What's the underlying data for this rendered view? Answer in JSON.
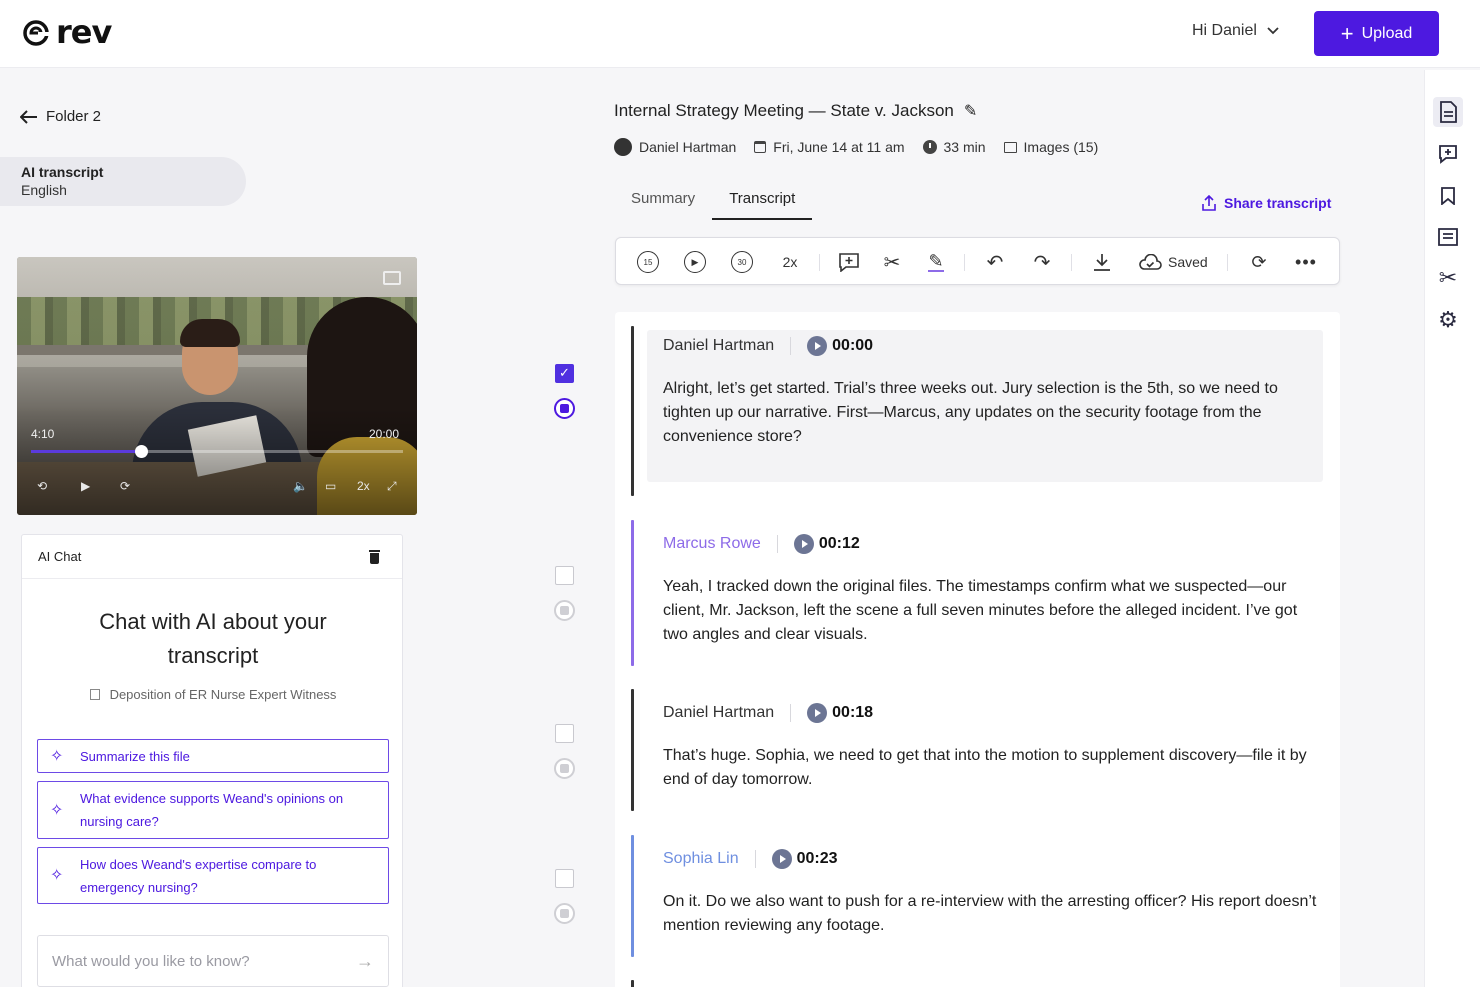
{
  "header": {
    "logo_text": "rev",
    "greeting": "Hi Daniel",
    "upload_label": "Upload",
    "accent_color": "#4d19e0"
  },
  "left": {
    "back_label": "Folder 2",
    "transcript_title": "AI transcript",
    "transcript_language": "English",
    "video": {
      "current_time": "4:10",
      "end_time": "20:00",
      "progress": 0.295,
      "speed_label": "2x"
    },
    "chat": {
      "header": "AI Chat",
      "title": "Chat with AI about your transcript",
      "file_name": "Deposition of ER Nurse Expert Witness",
      "suggestions": [
        "Summarize this file",
        "What evidence supports Weand's opinions on nursing care?",
        "How does Weand's expertise compare to emergency nursing?"
      ],
      "input_placeholder": "What would you like to know?"
    }
  },
  "doc": {
    "title": "Internal Strategy Meeting — State v. Jackson",
    "author": "Daniel Hartman",
    "date": "Fri, June 14 at 11 am",
    "duration": "33 min",
    "images": "Images (15)"
  },
  "tabs": {
    "summary": "Summary",
    "transcript": "Transcript",
    "active": "Transcript",
    "share_label": "Share transcript"
  },
  "toolbar": {
    "rewind_label": "15",
    "forward_label": "30",
    "speed_label": "2x",
    "saved_label": "Saved"
  },
  "transcript": [
    {
      "speaker": "Daniel Hartman",
      "time": "00:00",
      "color": "#333333",
      "text": "Alright, let’s get started. Trial’s three weeks out. Jury selection is the 5th, so we need to tighten up our narrative. First—Marcus, any updates on the security footage from the convenience store?",
      "checked": true
    },
    {
      "speaker": "Marcus Rowe",
      "time": "00:12",
      "color": "#8d6be8",
      "text": "Yeah, I tracked down the original files. The timestamps confirm what we suspected—our client, Mr. Jackson, left the scene a full seven minutes before the alleged incident. I’ve got two angles and clear visuals.",
      "checked": false
    },
    {
      "speaker": "Daniel Hartman",
      "time": "00:18",
      "color": "#333333",
      "text": "That’s huge. Sophia, we need to get that into the motion to supplement discovery—file it by end of day tomorrow.",
      "checked": false
    },
    {
      "speaker": "Sophia Lin",
      "time": "00:23",
      "color": "#6f8fe0",
      "text": "On it. Do we also want to push for a re-interview with the arresting officer? His report doesn’t mention reviewing any footage.",
      "checked": false
    }
  ]
}
